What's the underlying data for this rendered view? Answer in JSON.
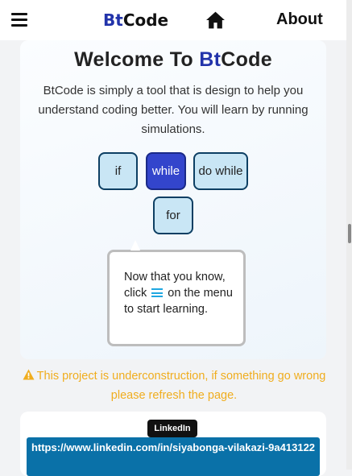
{
  "navbar": {
    "brand_prefix": "Bt",
    "brand_suffix": "Code",
    "about_label": "About",
    "icons": [
      "menu-icon",
      "home-icon"
    ]
  },
  "welcome": {
    "title_prefix": "Welcome To ",
    "title_accent": "Bt",
    "title_suffix": "Code",
    "intro": "BtCode is simply a tool that is design to help you understand coding better. You will learn by running simulations."
  },
  "loops": {
    "if_label": "if",
    "while_label": "while",
    "dowhile_label": "do while",
    "for_label": "for",
    "selected": "while"
  },
  "tooltip": {
    "text_before": "Now that you know, click ",
    "text_after": " on the menu to start learning."
  },
  "warning": {
    "text": "This project is underconstruction, if something go wrong please refresh the page."
  },
  "footer": {
    "badge": "LinkedIn",
    "url": "https://www.linkedin.com/in/siyabonga-vilakazi-9a413122"
  },
  "colors": {
    "accent": "#2233aa",
    "button_bg": "#c9e6f5",
    "button_active": "#3345cc",
    "warning": "#f0ad1e",
    "linkedin": "#0a71a8"
  }
}
